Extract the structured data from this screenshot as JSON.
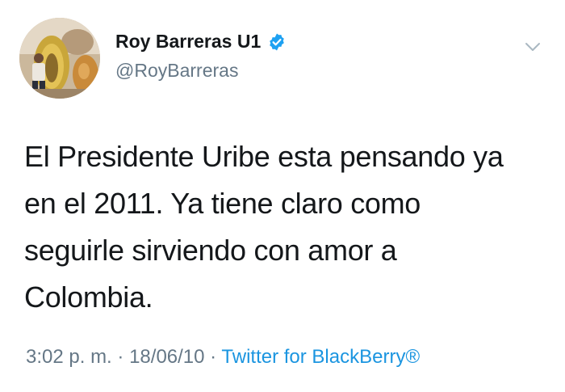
{
  "user": {
    "display_name": "Roy Barreras U1",
    "handle": "@RoyBarreras",
    "avatar_icon": "profile-photo",
    "verified_icon": "verified-badge-icon",
    "verified_color": "#1da1f2"
  },
  "menu": {
    "icon": "chevron-down-icon"
  },
  "tweet": {
    "lines": [
      "El Presidente Uribe esta pensando ya",
      "en el 2011. Ya tiene claro como",
      "seguirle sirviendo con amor a",
      "Colombia."
    ]
  },
  "meta": {
    "time": "3:02 p. m.",
    "separator": "·",
    "date": "18/06/10",
    "source": "Twitter for BlackBerry®",
    "source_color": "#1b95e0"
  }
}
